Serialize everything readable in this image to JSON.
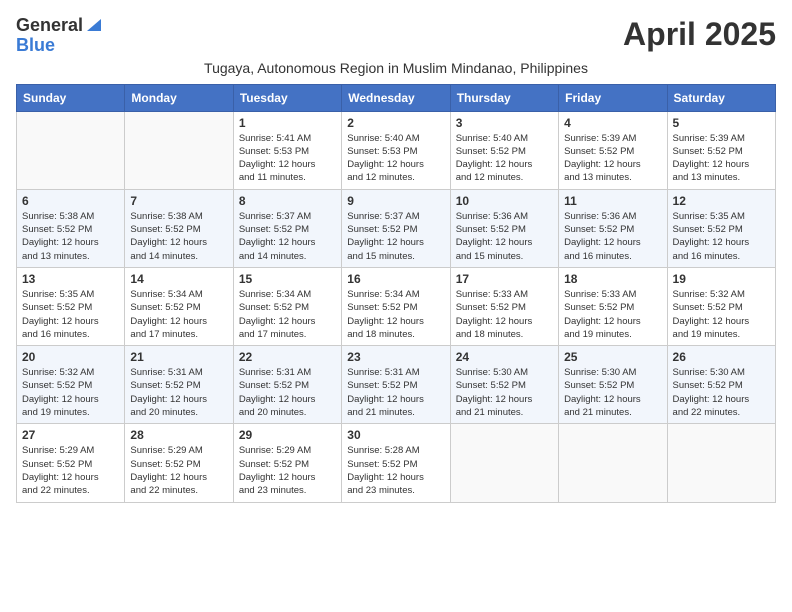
{
  "header": {
    "logo_general": "General",
    "logo_blue": "Blue",
    "month_title": "April 2025",
    "subtitle": "Tugaya, Autonomous Region in Muslim Mindanao, Philippines"
  },
  "weekdays": [
    "Sunday",
    "Monday",
    "Tuesday",
    "Wednesday",
    "Thursday",
    "Friday",
    "Saturday"
  ],
  "weeks": [
    [
      {
        "day": "",
        "info": ""
      },
      {
        "day": "",
        "info": ""
      },
      {
        "day": "1",
        "info": "Sunrise: 5:41 AM\nSunset: 5:53 PM\nDaylight: 12 hours\nand 11 minutes."
      },
      {
        "day": "2",
        "info": "Sunrise: 5:40 AM\nSunset: 5:53 PM\nDaylight: 12 hours\nand 12 minutes."
      },
      {
        "day": "3",
        "info": "Sunrise: 5:40 AM\nSunset: 5:52 PM\nDaylight: 12 hours\nand 12 minutes."
      },
      {
        "day": "4",
        "info": "Sunrise: 5:39 AM\nSunset: 5:52 PM\nDaylight: 12 hours\nand 13 minutes."
      },
      {
        "day": "5",
        "info": "Sunrise: 5:39 AM\nSunset: 5:52 PM\nDaylight: 12 hours\nand 13 minutes."
      }
    ],
    [
      {
        "day": "6",
        "info": "Sunrise: 5:38 AM\nSunset: 5:52 PM\nDaylight: 12 hours\nand 13 minutes."
      },
      {
        "day": "7",
        "info": "Sunrise: 5:38 AM\nSunset: 5:52 PM\nDaylight: 12 hours\nand 14 minutes."
      },
      {
        "day": "8",
        "info": "Sunrise: 5:37 AM\nSunset: 5:52 PM\nDaylight: 12 hours\nand 14 minutes."
      },
      {
        "day": "9",
        "info": "Sunrise: 5:37 AM\nSunset: 5:52 PM\nDaylight: 12 hours\nand 15 minutes."
      },
      {
        "day": "10",
        "info": "Sunrise: 5:36 AM\nSunset: 5:52 PM\nDaylight: 12 hours\nand 15 minutes."
      },
      {
        "day": "11",
        "info": "Sunrise: 5:36 AM\nSunset: 5:52 PM\nDaylight: 12 hours\nand 16 minutes."
      },
      {
        "day": "12",
        "info": "Sunrise: 5:35 AM\nSunset: 5:52 PM\nDaylight: 12 hours\nand 16 minutes."
      }
    ],
    [
      {
        "day": "13",
        "info": "Sunrise: 5:35 AM\nSunset: 5:52 PM\nDaylight: 12 hours\nand 16 minutes."
      },
      {
        "day": "14",
        "info": "Sunrise: 5:34 AM\nSunset: 5:52 PM\nDaylight: 12 hours\nand 17 minutes."
      },
      {
        "day": "15",
        "info": "Sunrise: 5:34 AM\nSunset: 5:52 PM\nDaylight: 12 hours\nand 17 minutes."
      },
      {
        "day": "16",
        "info": "Sunrise: 5:34 AM\nSunset: 5:52 PM\nDaylight: 12 hours\nand 18 minutes."
      },
      {
        "day": "17",
        "info": "Sunrise: 5:33 AM\nSunset: 5:52 PM\nDaylight: 12 hours\nand 18 minutes."
      },
      {
        "day": "18",
        "info": "Sunrise: 5:33 AM\nSunset: 5:52 PM\nDaylight: 12 hours\nand 19 minutes."
      },
      {
        "day": "19",
        "info": "Sunrise: 5:32 AM\nSunset: 5:52 PM\nDaylight: 12 hours\nand 19 minutes."
      }
    ],
    [
      {
        "day": "20",
        "info": "Sunrise: 5:32 AM\nSunset: 5:52 PM\nDaylight: 12 hours\nand 19 minutes."
      },
      {
        "day": "21",
        "info": "Sunrise: 5:31 AM\nSunset: 5:52 PM\nDaylight: 12 hours\nand 20 minutes."
      },
      {
        "day": "22",
        "info": "Sunrise: 5:31 AM\nSunset: 5:52 PM\nDaylight: 12 hours\nand 20 minutes."
      },
      {
        "day": "23",
        "info": "Sunrise: 5:31 AM\nSunset: 5:52 PM\nDaylight: 12 hours\nand 21 minutes."
      },
      {
        "day": "24",
        "info": "Sunrise: 5:30 AM\nSunset: 5:52 PM\nDaylight: 12 hours\nand 21 minutes."
      },
      {
        "day": "25",
        "info": "Sunrise: 5:30 AM\nSunset: 5:52 PM\nDaylight: 12 hours\nand 21 minutes."
      },
      {
        "day": "26",
        "info": "Sunrise: 5:30 AM\nSunset: 5:52 PM\nDaylight: 12 hours\nand 22 minutes."
      }
    ],
    [
      {
        "day": "27",
        "info": "Sunrise: 5:29 AM\nSunset: 5:52 PM\nDaylight: 12 hours\nand 22 minutes."
      },
      {
        "day": "28",
        "info": "Sunrise: 5:29 AM\nSunset: 5:52 PM\nDaylight: 12 hours\nand 22 minutes."
      },
      {
        "day": "29",
        "info": "Sunrise: 5:29 AM\nSunset: 5:52 PM\nDaylight: 12 hours\nand 23 minutes."
      },
      {
        "day": "30",
        "info": "Sunrise: 5:28 AM\nSunset: 5:52 PM\nDaylight: 12 hours\nand 23 minutes."
      },
      {
        "day": "",
        "info": ""
      },
      {
        "day": "",
        "info": ""
      },
      {
        "day": "",
        "info": ""
      }
    ]
  ]
}
